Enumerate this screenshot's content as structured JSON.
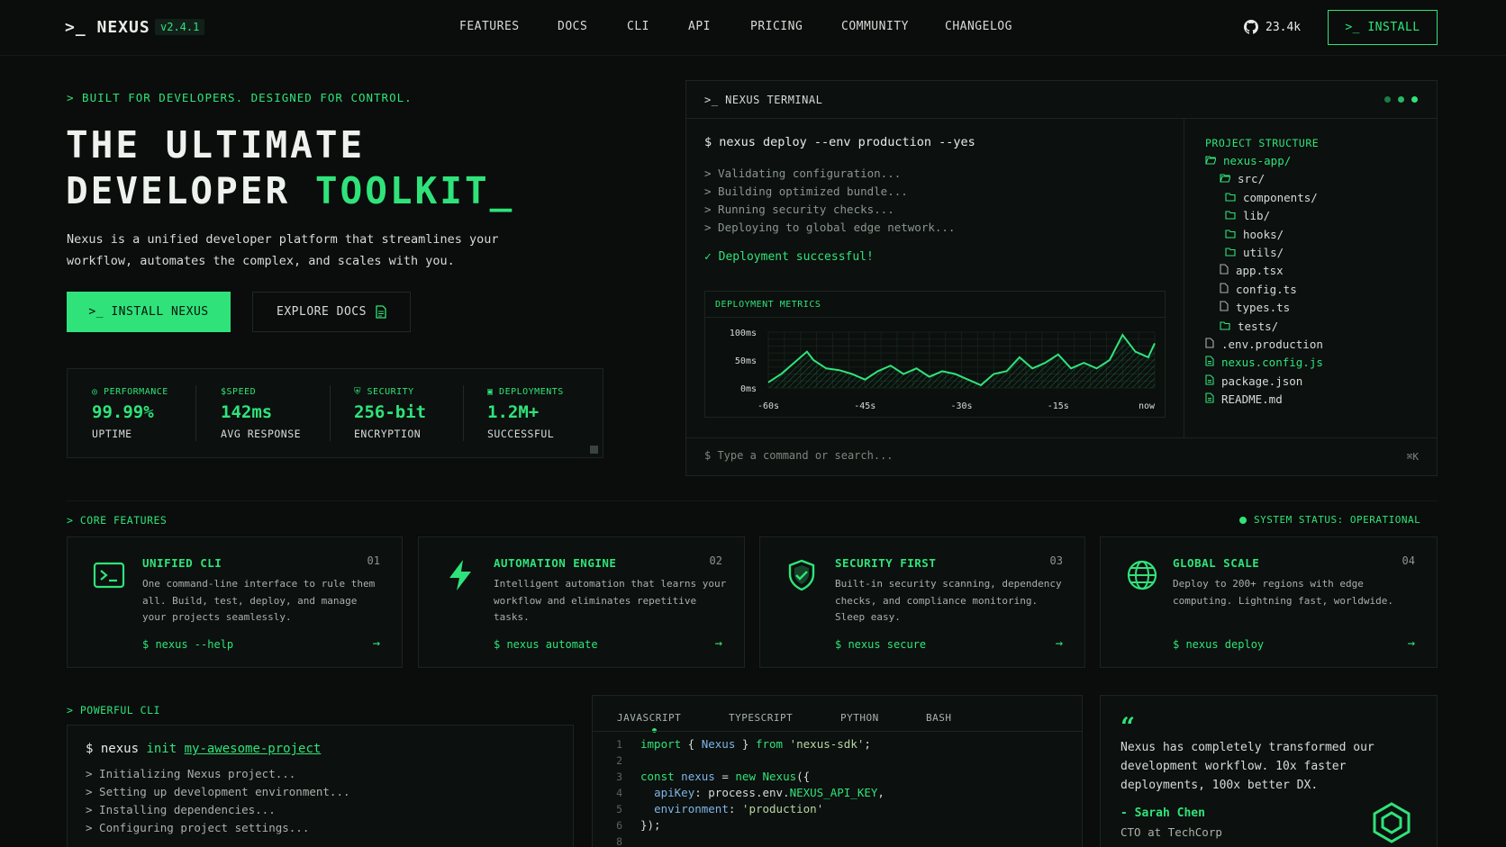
{
  "nav": {
    "logo": ">_ NEXUS",
    "version": "v2.4.1",
    "links": [
      "FEATURES",
      "DOCS",
      "CLI",
      "API",
      "PRICING",
      "COMMUNITY",
      "CHANGELOG"
    ],
    "stars": "23.4k",
    "install": ">_ INSTALL"
  },
  "hero": {
    "tag": "> BUILT FOR DEVELOPERS. DESIGNED FOR CONTROL.",
    "title_line1": "THE ULTIMATE",
    "title_line2a": "DEVELOPER ",
    "title_line2b": "TOOLKIT_",
    "description": "Nexus is a unified developer platform that streamlines your workflow, automates the complex, and scales with you.",
    "install_button": ">_ INSTALL NEXUS",
    "docs_button": "EXPLORE DOCS"
  },
  "stats": [
    {
      "icon": "gauge-icon",
      "label": "PERFORMANCE",
      "value": "99.99%",
      "sub": "UPTIME"
    },
    {
      "icon": "dollar-icon",
      "label": "SPEED",
      "value": "142ms",
      "sub": "AVG RESPONSE"
    },
    {
      "icon": "shield-icon",
      "label": "SECURITY",
      "value": "256-bit",
      "sub": "ENCRYPTION"
    },
    {
      "icon": "deploy-icon",
      "label": "DEPLOYMENTS",
      "value": "1.2M+",
      "sub": "SUCCESSFUL"
    }
  ],
  "terminal": {
    "title": ">_ NEXUS TERMINAL",
    "command": "$ nexus deploy --env production --yes",
    "logs": [
      ">  Validating configuration...",
      ">  Building optimized bundle...",
      ">  Running security checks...",
      ">  Deploying to global edge network..."
    ],
    "success": "✓  Deployment successful!",
    "metrics_title": "DEPLOYMENT METRICS",
    "input_placeholder": "$ Type a command or search...",
    "shortcut": "⌘K"
  },
  "chart_data": {
    "type": "area",
    "title": "DEPLOYMENT METRICS",
    "ytick_labels": [
      "100ms",
      "50ms",
      "0ms"
    ],
    "xtick_labels": [
      "-60s",
      "-45s",
      "-30s",
      "-15s",
      "now"
    ],
    "ylim": [
      0,
      100
    ],
    "xlim": [
      -60,
      0
    ],
    "x": [
      -60,
      -58,
      -56,
      -54,
      -53,
      -51,
      -49,
      -47,
      -45,
      -43,
      -41,
      -39,
      -37,
      -35,
      -33,
      -31,
      -29,
      -27,
      -25,
      -23,
      -21,
      -19,
      -17,
      -15,
      -13,
      -11,
      -9,
      -7,
      -5,
      -3,
      -1,
      0
    ],
    "values": [
      10,
      25,
      45,
      65,
      50,
      35,
      32,
      25,
      15,
      30,
      40,
      25,
      35,
      20,
      30,
      25,
      15,
      5,
      25,
      30,
      55,
      35,
      45,
      60,
      35,
      45,
      35,
      50,
      95,
      65,
      55,
      80
    ],
    "grid": true,
    "color": "#2fe37a"
  },
  "tree": {
    "title": "PROJECT STRUCTURE",
    "items": [
      {
        "name": "nexus-app/",
        "kind": "folder-open",
        "depth": 0,
        "accent": true
      },
      {
        "name": "src/",
        "kind": "folder-open",
        "depth": 1,
        "accent": false
      },
      {
        "name": "components/",
        "kind": "folder",
        "depth": 2,
        "accent": false
      },
      {
        "name": "lib/",
        "kind": "folder",
        "depth": 2,
        "accent": false
      },
      {
        "name": "hooks/",
        "kind": "folder",
        "depth": 2,
        "accent": false
      },
      {
        "name": "utils/",
        "kind": "folder",
        "depth": 2,
        "accent": false
      },
      {
        "name": "app.tsx",
        "kind": "file",
        "depth": 1,
        "accent": false
      },
      {
        "name": "config.ts",
        "kind": "file",
        "depth": 1,
        "accent": false
      },
      {
        "name": "types.ts",
        "kind": "file",
        "depth": 1,
        "accent": false
      },
      {
        "name": "tests/",
        "kind": "folder",
        "depth": 1,
        "accent": false
      },
      {
        "name": ".env.production",
        "kind": "file",
        "depth": 0,
        "accent": false
      },
      {
        "name": "nexus.config.js",
        "kind": "file-code",
        "depth": 0,
        "accent": true
      },
      {
        "name": "package.json",
        "kind": "file-code",
        "depth": 0,
        "accent": false
      },
      {
        "name": "README.md",
        "kind": "file-code",
        "depth": 0,
        "accent": false
      }
    ]
  },
  "features": {
    "label": "> CORE FEATURES",
    "status": "SYSTEM STATUS: OPERATIONAL",
    "cards": [
      {
        "icon": "terminal-icon",
        "title": "UNIFIED CLI",
        "num": "01",
        "desc": "One command-line interface to rule them all. Build, test, deploy, and manage your projects seamlessly.",
        "cmd": "$ nexus --help"
      },
      {
        "icon": "lightning-icon",
        "title": "AUTOMATION ENGINE",
        "num": "02",
        "desc": "Intelligent automation that learns your workflow and eliminates repetitive tasks.",
        "cmd": "$ nexus automate"
      },
      {
        "icon": "shield-check-icon",
        "title": "SECURITY FIRST",
        "num": "03",
        "desc": "Built-in security scanning, dependency checks, and compliance monitoring. Sleep easy.",
        "cmd": "$ nexus secure"
      },
      {
        "icon": "globe-icon",
        "title": "GLOBAL SCALE",
        "num": "04",
        "desc": "Deploy to 200+ regions with edge computing. Lightning fast, worldwide.",
        "cmd": "$ nexus deploy"
      }
    ]
  },
  "cli": {
    "label": "> POWERFUL CLI",
    "cmd_prefix": "$ nexus ",
    "cmd_verb": "init ",
    "cmd_arg": "my-awesome-project",
    "logs": [
      ">  Initializing Nexus project...",
      ">  Setting up development environment...",
      ">  Installing dependencies...",
      ">  Configuring project settings..."
    ]
  },
  "code": {
    "tabs": [
      "JAVASCRIPT",
      "TYPESCRIPT",
      "PYTHON",
      "BASH"
    ],
    "line_numbers": [
      "1",
      "2",
      "3",
      "4",
      "5",
      "6",
      "8"
    ]
  },
  "testimonial": {
    "quote_mark": "“",
    "text": "Nexus has completely transformed our development workflow. 10x faster deployments, 100x better DX.",
    "author": "- Sarah Chen",
    "role": "CTO at TechCorp"
  },
  "colors": {
    "accent": "#2fe37a",
    "background": "#0a0d0b",
    "panel": "#0c100e",
    "border": "#1c2520"
  }
}
